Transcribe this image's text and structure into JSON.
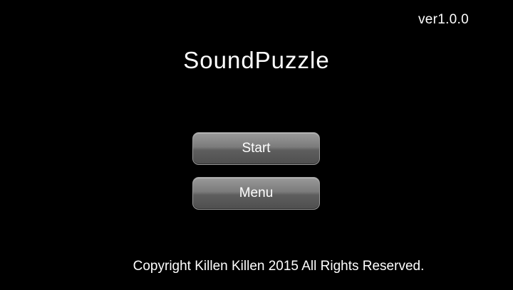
{
  "game": {
    "version": "ver1.0.0",
    "title": "SoundPuzzle",
    "buttons": {
      "start_label": "Start",
      "menu_label": "Menu"
    },
    "copyright": "Copyright Killen Killen 2015 All Rights Reserved."
  },
  "colors": {
    "background": "#000000",
    "text": "#ffffff",
    "button_top": "#9a9a9a",
    "button_bottom": "#4f4f4f"
  }
}
